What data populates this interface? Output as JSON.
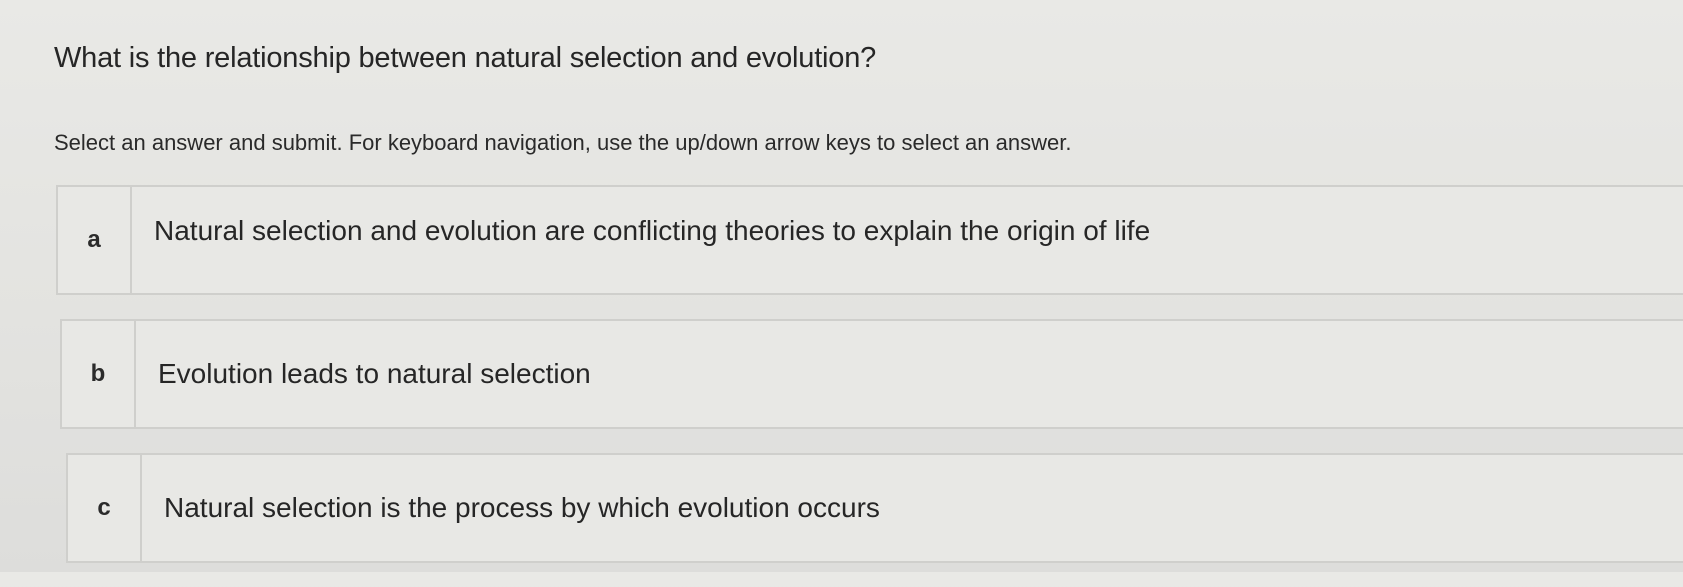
{
  "question": {
    "prompt": "What is the relationship between natural selection and evolution?",
    "instructions": "Select an answer and submit. For keyboard navigation, use the up/down arrow keys to select an answer."
  },
  "options": [
    {
      "letter": "a",
      "text": "Natural selection and evolution are conflicting theories to explain the origin of life"
    },
    {
      "letter": "b",
      "text": "Evolution leads to natural selection"
    },
    {
      "letter": "c",
      "text": "Natural selection is the process by which evolution occurs"
    }
  ]
}
